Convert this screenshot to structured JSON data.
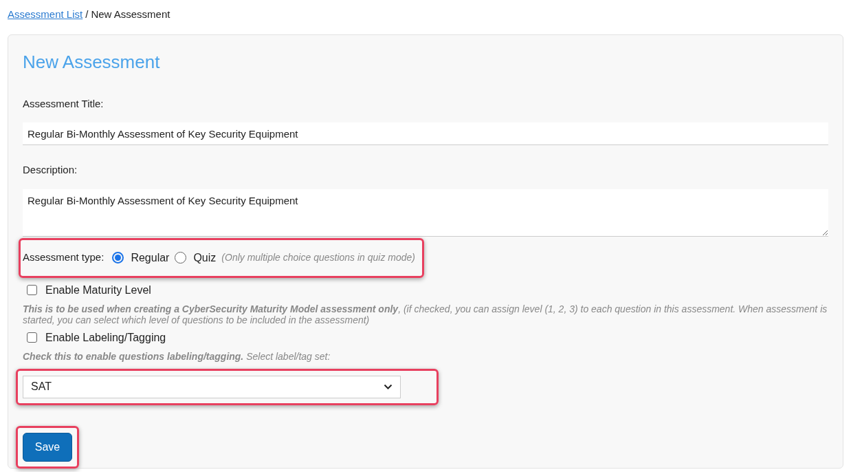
{
  "breadcrumb": {
    "link": "Assessment List",
    "separator": "/",
    "current": "New Assessment"
  },
  "form": {
    "title": "New Assessment",
    "title_field": {
      "label": "Assessment Title:",
      "value": "Regular Bi-Monthly Assessment of Key Security Equipment"
    },
    "description_field": {
      "label": "Description:",
      "value": "Regular Bi-Monthly Assessment of Key Security Equipment"
    },
    "assessment_type": {
      "label": "Assessment type:",
      "highlighted": true,
      "options": [
        {
          "label": "Regular",
          "selected": true
        },
        {
          "label": "Quiz",
          "selected": false
        }
      ],
      "note": "(Only multiple choice questions in quiz mode)"
    },
    "options": [
      {
        "label": "Enable Maturity Level",
        "checked": false,
        "help": "**This is to be used when creating a CyberSecurity Maturity Model assessment only**, (if checked, you can assign level (1, 2, 3) to each question in this assessment. When assessment is started, you can select which level of questions to be included in the assessment)"
      },
      {
        "label": "Enable Labeling/Tagging",
        "checked": false,
        "help": "**Check this to enable questions labeling/tagging.** Select label/tag set:"
      }
    ],
    "label_set": {
      "value": "SAT",
      "highlighted": true
    },
    "save_button": {
      "label": "Save",
      "highlighted": true
    }
  }
}
